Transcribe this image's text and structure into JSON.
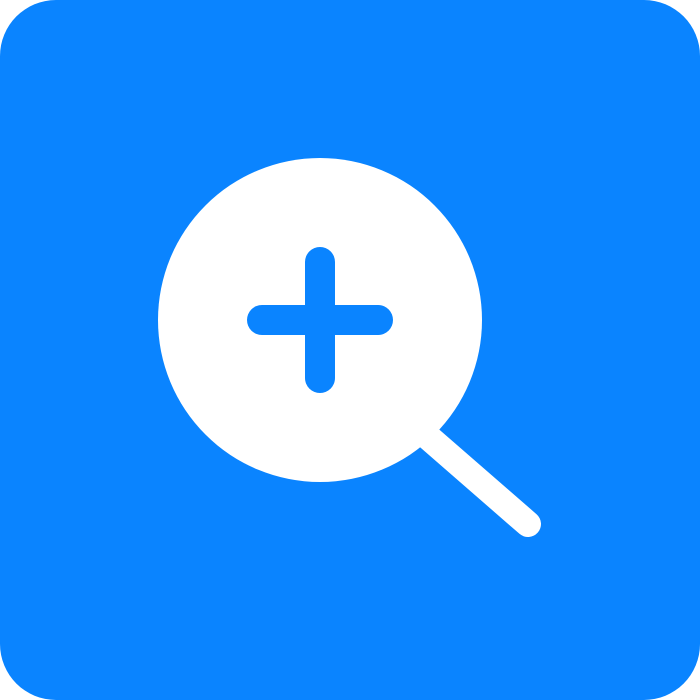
{
  "app_icon": {
    "icon": "zoom-in-icon",
    "glyph": "magnifying-glass-with-plus",
    "colors": {
      "background": "#0A84FF",
      "foreground": "#FFFFFF",
      "plus": "#0A84FF"
    }
  }
}
